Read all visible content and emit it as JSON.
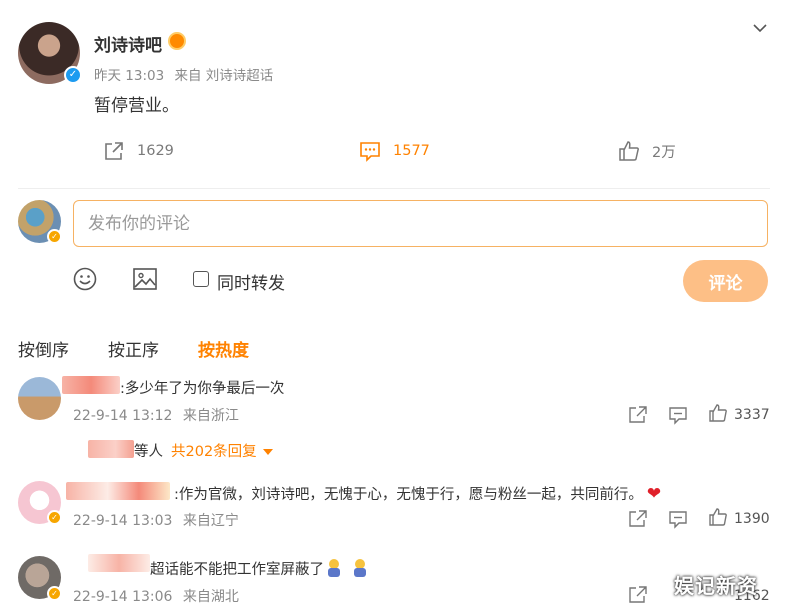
{
  "post": {
    "author": "刘诗诗吧",
    "time": "昨天 13:03",
    "source": "来自 刘诗诗超话",
    "text": "暂停营业。",
    "shares": "1629",
    "comments": "1577",
    "likes": "2万"
  },
  "composer": {
    "placeholder": "发布你的评论",
    "repost_label": "同时转发",
    "submit_label": "评论"
  },
  "sort_tabs": [
    "按倒序",
    "按正序",
    "按热度"
  ],
  "comments": [
    {
      "text": ":多少年了为你争最后一次",
      "time": "22-9-14 13:12",
      "location": "来自浙江",
      "likes": "3337",
      "reply_etc": "等人",
      "reply_count": "共202条回复"
    },
    {
      "text": ":作为官微，刘诗诗吧，无愧于心，无愧于行，愿与粉丝一起，共同前行。",
      "time": "22-9-14 13:03",
      "location": "来自辽宁",
      "likes": "1390"
    },
    {
      "text": "超话能不能把工作室屏蔽了",
      "time": "22-9-14 13:06",
      "location": "来自湖北",
      "likes": "1162"
    }
  ],
  "watermark": "娱记新资",
  "colors": {
    "accent": "#ff8200",
    "input_border": "#f6b263",
    "button": "#fdbf86",
    "verified": "#1d9bf0"
  }
}
